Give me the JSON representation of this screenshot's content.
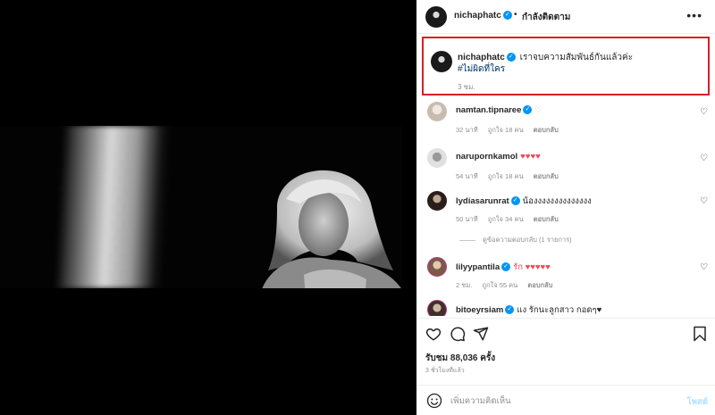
{
  "post": {
    "author": "nichaphatc",
    "follow_status": "กำลังติดตาม",
    "separator": "•",
    "more_icon": "more-horizontal-icon",
    "verified_mark": "✓"
  },
  "caption": {
    "author": "nichaphatc",
    "text": "เราจบความสัมพันธ์กันแล้วค่ะ",
    "hashtag": "#ไม่ผิดที่ใคร",
    "time": "3 ชม."
  },
  "comments": [
    {
      "user": "namtan.tipnaree",
      "text": "♡",
      "time": "32 นาที",
      "likes": "ถูกใจ 18 คน",
      "reply": "ตอบกลับ",
      "verified": true,
      "avatar_color": "#d8d0c8"
    },
    {
      "user": "narupornkamol",
      "text": "♥♥♥♥",
      "time": "54 นาที",
      "likes": "ถูกใจ 18 คน",
      "reply": "ตอบกลับ",
      "verified": false,
      "avatar_color": "#b8b8b8"
    },
    {
      "user": "lydiasarunrat",
      "text": "น้องงงงงงงงงงงงงง",
      "time": "50 นาที",
      "likes": "ถูกใจ 34 คน",
      "reply": "ตอบกลับ",
      "verified": true,
      "avatar_color": "#3a2e2a"
    },
    {
      "user": "lilyypantila",
      "text": "รัก ♥♥♥♥♥",
      "time": "2 ชม.",
      "likes": "ถูกใจ 55 คน",
      "reply": "ตอบกลับ",
      "verified": true,
      "avatar_color": "#c9a68a"
    },
    {
      "user": "bitoeyrsiam",
      "text": "แง รักนะลูกสาว กอดๆ♥",
      "time": "",
      "likes": "",
      "reply": "",
      "verified": true,
      "avatar_color": "#5b4a44"
    }
  ],
  "view_replies": "ดูข้อความตอบกลับ (1 รายการ)",
  "actions": {
    "like_icon": "heart-icon",
    "comment_icon": "comment-icon",
    "share_icon": "share-icon",
    "save_icon": "bookmark-icon"
  },
  "stats": {
    "views": "รับชม 88,036 ครั้ง",
    "posted": "3 ชั่วโมงที่แล้ว"
  },
  "composer": {
    "placeholder": "เพิ่มความคิดเห็น",
    "post_label": "โพสต์",
    "emoji_icon": "emoji-icon"
  },
  "colors": {
    "highlight_border": "#d81f26",
    "verified": "#0095f6",
    "heart": "#ed4956",
    "link": "#00376b",
    "post_disabled": "#b2dffc"
  }
}
